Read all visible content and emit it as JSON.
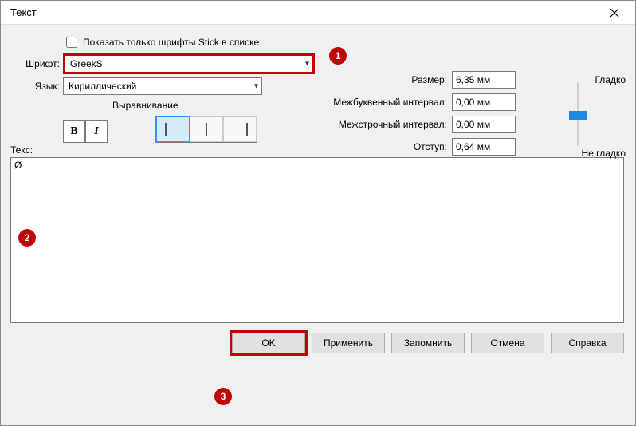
{
  "title": "Текст",
  "checkbox_label": "Показать только шрифты Stick в списке",
  "labels": {
    "font": "Шрифт:",
    "language": "Язык:",
    "size": "Размер:",
    "letter_spacing": "Межбуквенный интервал:",
    "line_spacing": "Межстрочный интервал:",
    "indent": "Отступ:",
    "alignment": "Выравнивание",
    "text": "Текс:"
  },
  "font_value": "GreekS",
  "language_value": "Кириллический",
  "size_value": "6,35 мм",
  "letter_spacing_value": "0,00 мм",
  "line_spacing_value": "0,00 мм",
  "indent_value": "0,64 мм",
  "slider_top": "Гладко",
  "slider_bottom": "Не гладко",
  "text_value": "Ø",
  "buttons": {
    "ok": "OK",
    "apply": "Применить",
    "remember": "Запомнить",
    "cancel": "Отмена",
    "help": "Справка"
  },
  "callouts": {
    "c1": "1",
    "c2": "2",
    "c3": "3"
  },
  "bold": "B",
  "italic": "I"
}
